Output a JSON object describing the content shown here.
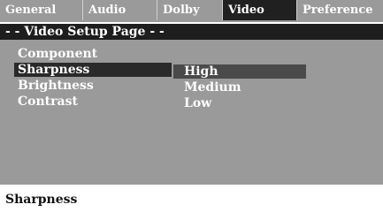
{
  "tabs": [
    {
      "label": "General"
    },
    {
      "label": "Audio"
    },
    {
      "label": "Dolby"
    },
    {
      "label": "Video",
      "active": true
    },
    {
      "label": "Preference"
    }
  ],
  "header": {
    "title": "- - Video Setup Page - -"
  },
  "menu": {
    "items": [
      {
        "label": "Component"
      },
      {
        "label": "Sharpness",
        "selected": true
      },
      {
        "label": "Brightness"
      },
      {
        "label": "Contrast"
      }
    ]
  },
  "submenu": {
    "options": [
      {
        "label": "High",
        "selected": true
      },
      {
        "label": "Medium"
      },
      {
        "label": "Low"
      }
    ]
  },
  "footer": {
    "text": "Sharpness"
  },
  "colors": {
    "panel": "#9a9a9a",
    "header": "#1e1e1e",
    "active_tab": "#202020",
    "selection": "#2a2a2a",
    "option_selection": "#4a4a4a"
  }
}
